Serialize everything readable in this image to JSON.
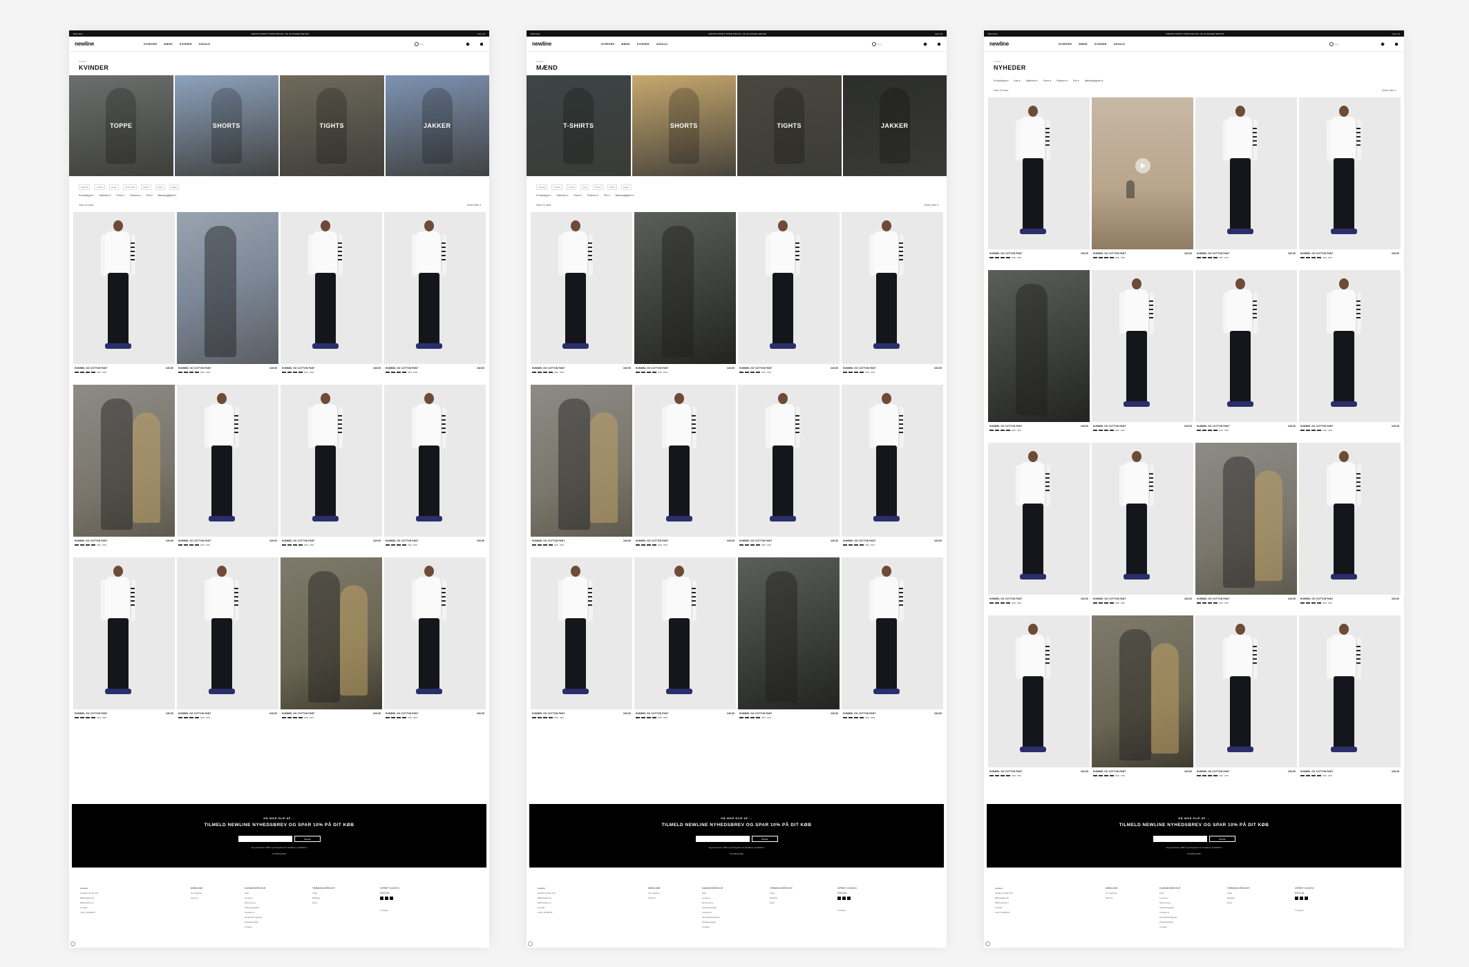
{
  "topbar": {
    "left": "Danmark",
    "center": "GRATIS FRAGT OVER 500 KR. OG 30 DAGES RETUR",
    "right": "Log ind"
  },
  "nav": {
    "logo": "newline",
    "menu": [
      "NYHEDER",
      "MÆND",
      "KVINDER",
      "UDSALG"
    ],
    "search_placeholder": "Søg"
  },
  "pages": [
    {
      "crumb": "Forside /",
      "title": "KVINDER",
      "categories": [
        "TOPPE",
        "SHORTS",
        "TIGHTS",
        "JAKKER"
      ],
      "subcats": [
        "Løbetøj",
        "T-shirts",
        "Toppe",
        "Sports BH",
        "Shorts",
        "Tights",
        "Jakker"
      ],
      "filters": [
        "Produkttype ▾",
        "Størrelse ▾",
        "Farve ▾",
        "Pasform ▾",
        "Pris ▾",
        "Bæredygtighed ▾"
      ],
      "count": "Viser 24 varer",
      "sort": "Sortér efter ▾"
    },
    {
      "crumb": "Forside /",
      "title": "MÆND",
      "categories": [
        "T-SHIRTS",
        "SHORTS",
        "TIGHTS",
        "JAKKER"
      ],
      "subcats": [
        "Løbetøj",
        "T-shirts",
        "Toppe",
        "Vest",
        "Shorts",
        "Tights",
        "Jakker"
      ],
      "filters": [
        "Produkttype ▾",
        "Størrelse ▾",
        "Farve ▾",
        "Pasform ▾",
        "Pris ▾",
        "Bæredygtighed ▾"
      ],
      "count": "Viser 24 varer",
      "sort": "Sortér efter ▾"
    },
    {
      "crumb": "Forside /",
      "title": "NYHEDER",
      "filters": [
        "Produkttype ▾",
        "Køn ▾",
        "Størrelse ▾",
        "Farve ▾",
        "Pasform ▾",
        "Pris ▾",
        "Bæredygtighed ▾"
      ],
      "count": "Viser 24 varer",
      "sort": "Sortér efter ▾"
    }
  ],
  "product": {
    "name": "HUMMEL GO COTTON PANT",
    "price": "349,95"
  },
  "newsletter": {
    "pre": "GÅ IKKE GLIP AF ...",
    "headline": "TILMELD NEWLINE NYHEDSBREV OG SPAR 10% PÅ DIT KØB",
    "button": "Tilmeld",
    "consent": "Jeg accepterer vilkår og betingelser for Newlines nyhedsbrev",
    "privacy": "Privatlivspolitik"
  },
  "footer": {
    "col1": [
      "newline",
      "Newline Nordic A/S",
      "Balticagade 20",
      "8000 Aarhus C",
      "Kontakt",
      "CVR: 12345678"
    ],
    "col2_head": "NEWLINE",
    "col2": [
      "Om Newline",
      "Karriere"
    ],
    "col3_head": "KUNDESERVICE",
    "col3": [
      "FAQ",
      "Levering",
      "Returnering",
      "Størrelsesguide",
      "Kontakt os",
      "Handelsbetingelser",
      "Privatlivspolitik",
      "Cookies"
    ],
    "col4_head": "TERMSOVERSIGT",
    "col4": [
      "Fragt",
      "Betaling",
      "Retur"
    ],
    "col5_head": "OPRET KONTO",
    "col5_sub": "SOCIAL",
    "payment": "Trustpilot"
  },
  "colors": {
    "black": "#000000",
    "white": "#ffffff",
    "studio_bg": "#e9e9e9"
  }
}
